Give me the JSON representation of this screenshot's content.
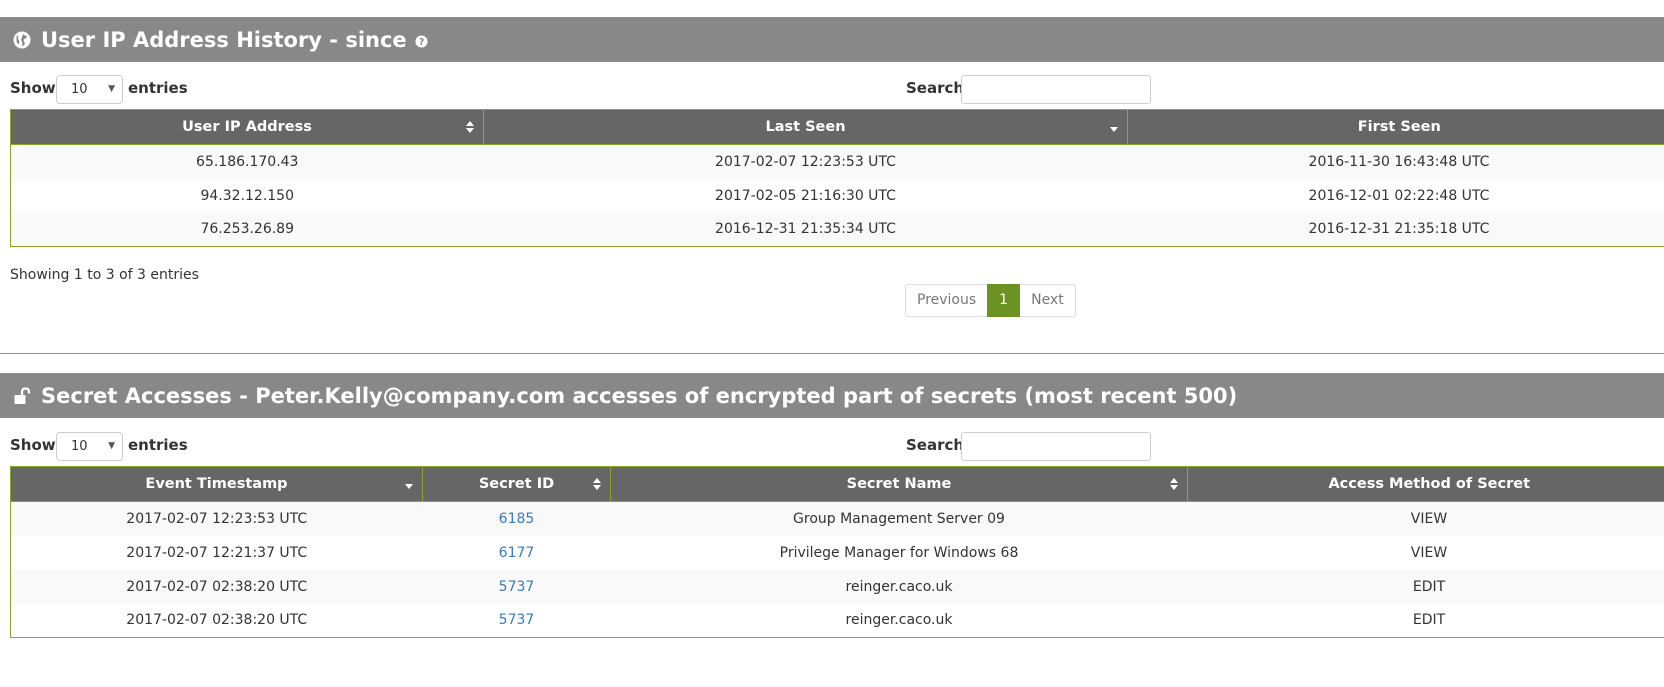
{
  "ip_panel": {
    "title": "User IP Address History - since",
    "length_label_show": "Show",
    "length_value": "10",
    "length_label_entries": "entries",
    "search_label": "Search:",
    "search_value": "",
    "columns": [
      "User IP Address",
      "Last Seen",
      "First Seen"
    ],
    "rows": [
      [
        "65.186.170.43",
        "2017-02-07 12:23:53 UTC",
        "2016-11-30 16:43:48 UTC"
      ],
      [
        "94.32.12.150",
        "2017-02-05 21:16:30 UTC",
        "2016-12-01 02:22:48 UTC"
      ],
      [
        "76.253.26.89",
        "2016-12-31 21:35:34 UTC",
        "2016-12-31 21:35:18 UTC"
      ]
    ],
    "info": "Showing 1 to 3 of 3 entries",
    "pagination": {
      "previous": "Previous",
      "current": "1",
      "next": "Next"
    }
  },
  "access_panel": {
    "title": "Secret Accesses - Peter.Kelly@company.com accesses of encrypted part of secrets (most recent 500)",
    "length_label_show": "Show",
    "length_value": "10",
    "length_label_entries": "entries",
    "search_label": "Search:",
    "search_value": "",
    "columns": [
      "Event Timestamp",
      "Secret ID",
      "Secret Name",
      "Access Method of Secret"
    ],
    "rows": [
      [
        "2017-02-07 12:23:53 UTC",
        "6185",
        "Group Management Server 09",
        "VIEW"
      ],
      [
        "2017-02-07 12:21:37 UTC",
        "6177",
        "Privilege Manager for Windows 68",
        "VIEW"
      ],
      [
        "2017-02-07 02:38:20 UTC",
        "5737",
        "reinger.caco.uk",
        "EDIT"
      ],
      [
        "2017-02-07 02:38:20 UTC",
        "5737",
        "reinger.caco.uk",
        "EDIT"
      ]
    ]
  },
  "icons": {
    "ip_header": "globe-icon",
    "ip_help": "help-icon",
    "access_header": "unlock-icon",
    "sort_both": "sort-both-icon",
    "sort_desc": "sort-desc-icon"
  },
  "colors": {
    "header_bg": "#888888",
    "table_head_bg": "#666666",
    "accent_border": "#8aa629",
    "pager_active": "#6b9223",
    "link": "#3a7abd"
  }
}
